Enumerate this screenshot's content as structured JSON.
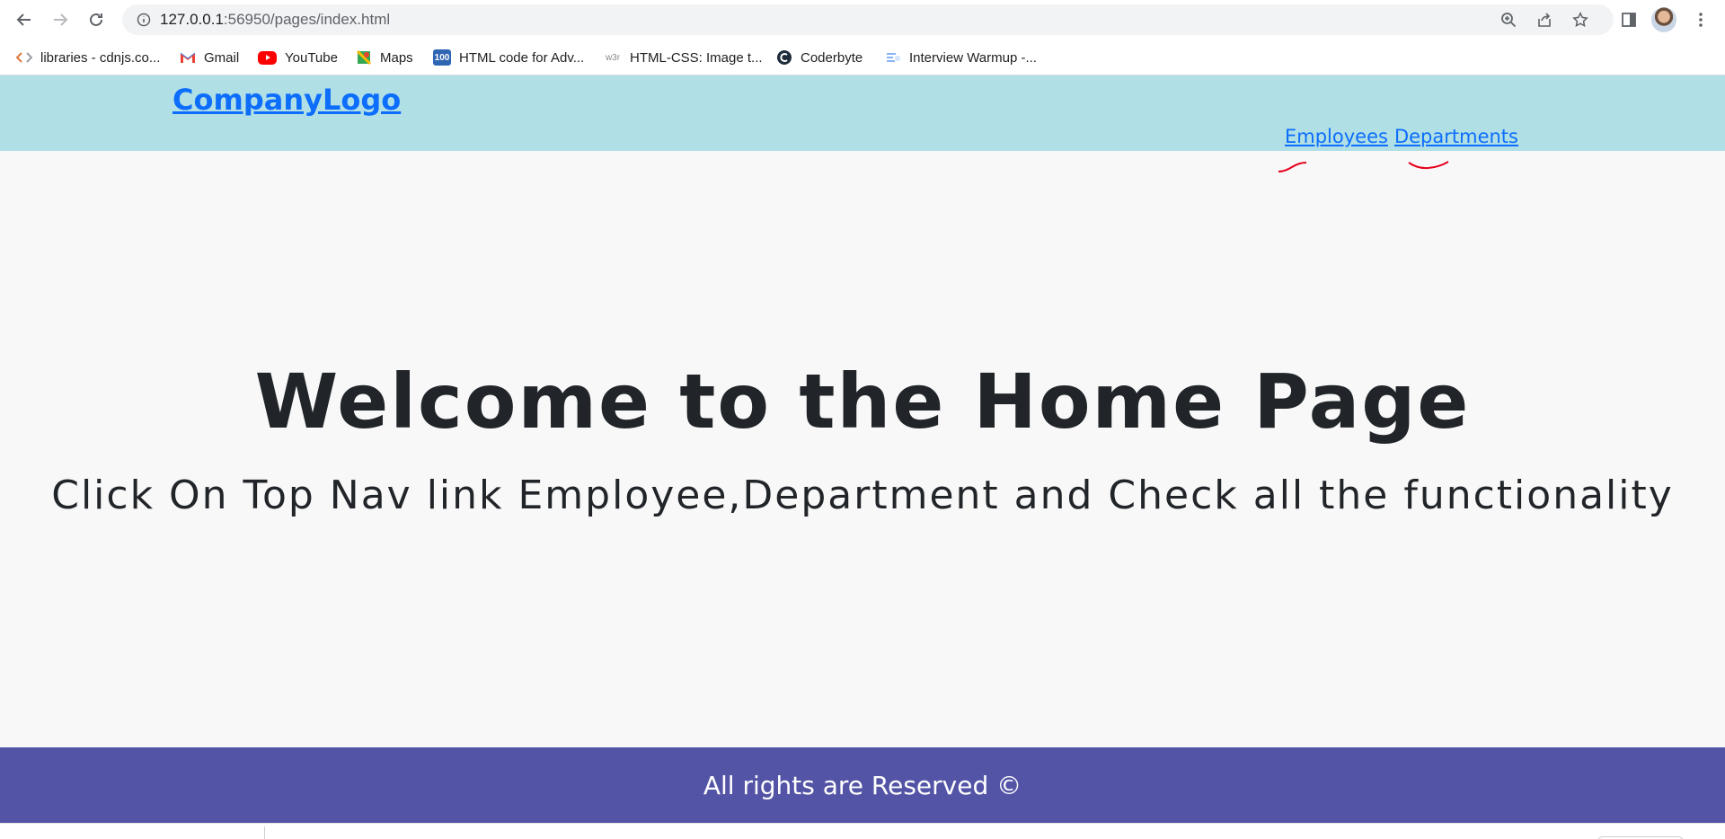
{
  "browser": {
    "url_host": "127.0.0.1",
    "url_path": ":56950/pages/index.html",
    "bookmarks": [
      {
        "label": "libraries - cdnjs.co...",
        "icon": "code-icon"
      },
      {
        "label": "Gmail",
        "icon": "gmail-icon"
      },
      {
        "label": "YouTube",
        "icon": "youtube-icon"
      },
      {
        "label": "Maps",
        "icon": "maps-icon"
      },
      {
        "label": "HTML code for Adv...",
        "icon": "badge-100-icon",
        "icon_text": "100"
      },
      {
        "label": "HTML-CSS: Image t...",
        "icon": "w3r-icon",
        "icon_text": "w3r"
      },
      {
        "label": "Coderbyte",
        "icon": "coderbyte-icon"
      },
      {
        "label": "Interview Warmup -...",
        "icon": "interview-warmup-icon"
      }
    ]
  },
  "header": {
    "logo": "CompanyLogo",
    "nav": [
      {
        "label": "Employees"
      },
      {
        "label": "Departments"
      }
    ]
  },
  "hero": {
    "title": "Welcome to the Home Page",
    "subtitle": "Click On Top Nav link Employee,Department and Check all the functionality"
  },
  "footer": {
    "text": "All rights are Reserved ©"
  },
  "colors": {
    "header_bg": "#b0dfe5",
    "link": "#0d6efd",
    "footer_bg": "#5354a6",
    "page_bg": "#f8f8f8",
    "annotation": "#e8001c"
  }
}
